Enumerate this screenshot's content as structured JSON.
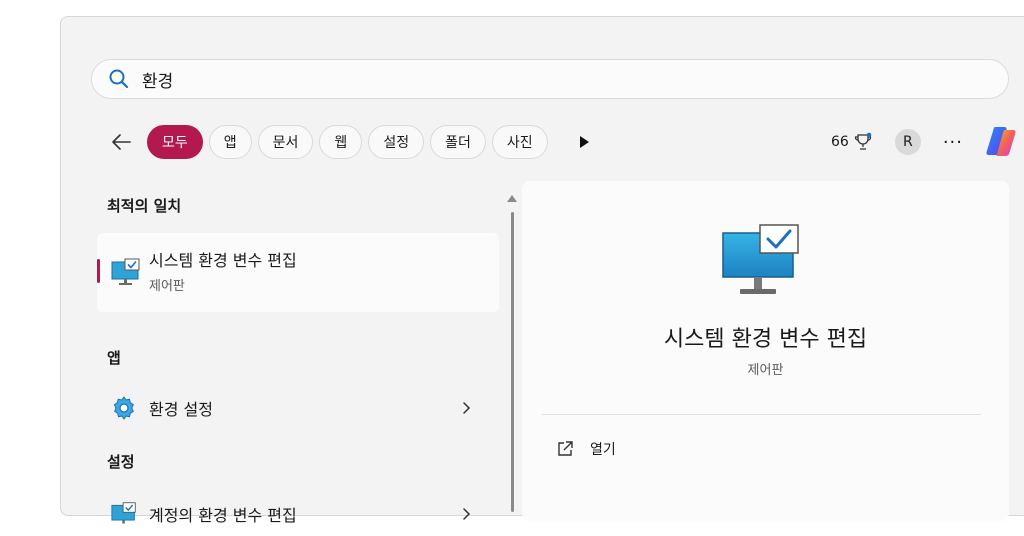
{
  "search": {
    "value": "환경",
    "icon": "search-icon"
  },
  "filters": {
    "tabs": [
      {
        "label": "모두",
        "active": true
      },
      {
        "label": "앱"
      },
      {
        "label": "문서"
      },
      {
        "label": "웹"
      },
      {
        "label": "설정"
      },
      {
        "label": "폴더"
      },
      {
        "label": "사진"
      }
    ]
  },
  "header": {
    "points": "66",
    "avatar_initial": "R",
    "more": "···"
  },
  "results": {
    "best_match_title": "최적의 일치",
    "best_match": {
      "title": "시스템 환경 변수 편집",
      "subtitle": "제어판",
      "icon": "system-monitor-icon"
    },
    "apps_title": "앱",
    "apps": [
      {
        "label": "환경 설정",
        "icon": "gear-icon"
      }
    ],
    "settings_title": "설정",
    "settings": [
      {
        "label": "계정의 환경 변수 편집",
        "icon": "system-monitor-icon"
      }
    ]
  },
  "detail": {
    "title": "시스템 환경 변수 편집",
    "subtitle": "제어판",
    "open_label": "열기"
  },
  "colors": {
    "accent": "#b3184f",
    "window_bg": "#f3f3f3",
    "panel_bg": "#fbfbfb"
  }
}
